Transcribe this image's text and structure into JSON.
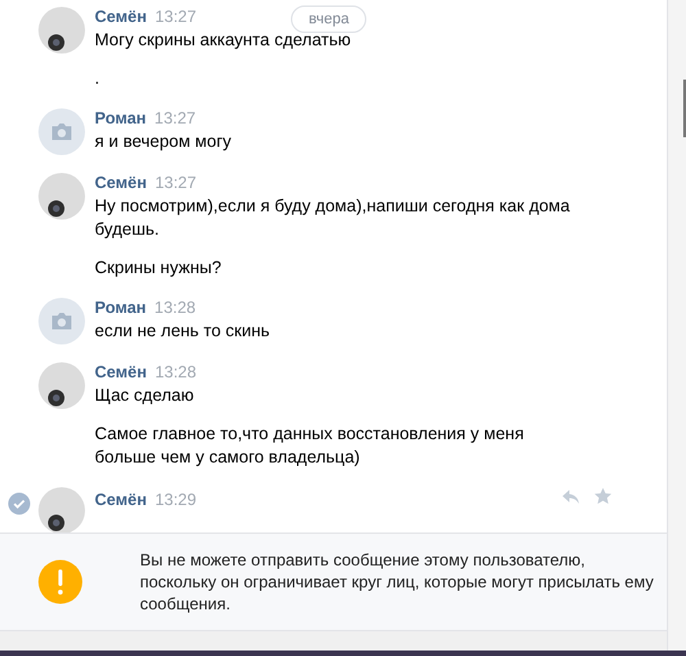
{
  "date_pill": "вчера",
  "messages": [
    {
      "author": "Семён",
      "time": "13:27",
      "selected": false,
      "show_actions": false,
      "paragraphs": [
        "Могу скрины аккаунта сделатью",
        "."
      ]
    },
    {
      "author": "Роман",
      "time": "13:27",
      "kind": "camera",
      "selected": false,
      "show_actions": false,
      "paragraphs": [
        "я и вечером могу"
      ]
    },
    {
      "author": "Семён",
      "time": "13:27",
      "selected": false,
      "show_actions": false,
      "paragraphs": [
        "Ну посмотрим),если я буду дома),напиши сегодня как дома будешь.",
        "Скрины нужны?"
      ]
    },
    {
      "author": "Роман",
      "time": "13:28",
      "kind": "camera",
      "selected": false,
      "show_actions": false,
      "paragraphs": [
        "если не лень то скинь"
      ]
    },
    {
      "author": "Семён",
      "time": "13:28",
      "selected": false,
      "show_actions": false,
      "paragraphs": [
        "Щас сделаю",
        "Самое главное то,что данных восстановления у меня больше чем у самого владельца)"
      ]
    },
    {
      "author": "Семён",
      "time": "13:29",
      "selected": true,
      "show_actions": true
    }
  ],
  "notice": {
    "text": "Вы не можете отправить сообщение этому пользователю, поскольку он ограничивает круг лиц, которые могут присылать ему сообщения."
  }
}
